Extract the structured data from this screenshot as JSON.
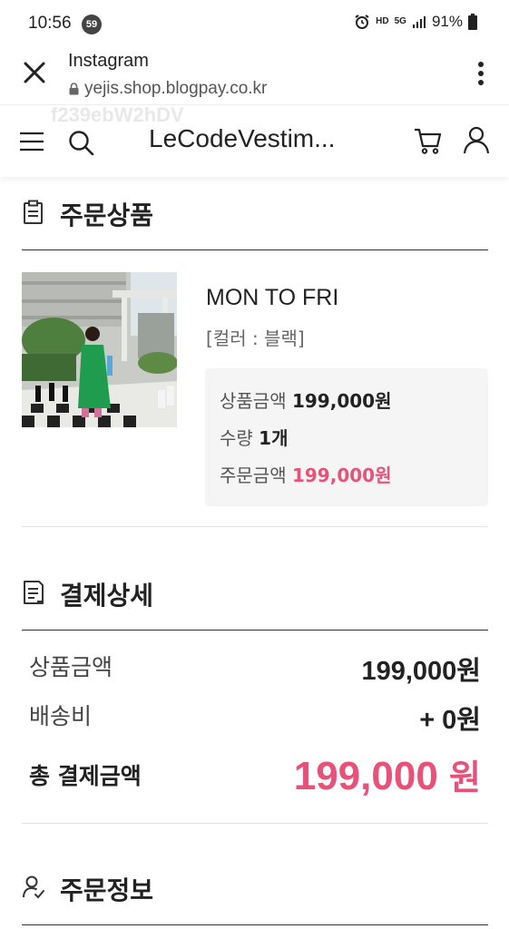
{
  "status_bar": {
    "time": "10:56",
    "badge": "59",
    "hd": "HD",
    "network": "5G",
    "battery": "91%"
  },
  "browser": {
    "title": "Instagram",
    "url": "yejis.shop.blogpay.co.kr"
  },
  "shop": {
    "watermark": "f239ebW2hDV",
    "title": "LeCodeVestim..."
  },
  "order_items": {
    "heading": "주문상품",
    "product": {
      "name": "MON TO FRI",
      "option": "[컬러 : 블랙]",
      "price_label": "상품금액",
      "price_value": "199,000원",
      "qty_label": "수량",
      "qty_value": "1개",
      "order_label": "주문금액",
      "order_value": "199,000원"
    }
  },
  "payment_details": {
    "heading": "결제상세",
    "product_amount_label": "상품금액",
    "product_amount_value": "199,000원",
    "shipping_label": "배송비",
    "shipping_value": "+ 0원",
    "total_label": "총 결제금액",
    "total_amount": "199,000",
    "total_unit": "원"
  },
  "order_info": {
    "heading": "주문정보"
  },
  "colors": {
    "accent_pink": "#e8517a",
    "text": "#222222",
    "box_bg": "#f5f5f5"
  }
}
